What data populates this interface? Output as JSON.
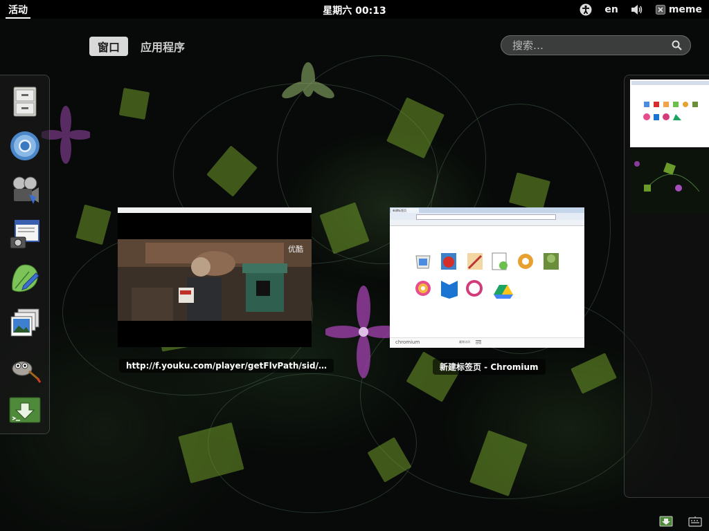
{
  "topbar": {
    "activities": "活动",
    "clock": "星期六 00:13",
    "keyboard_layout": "en",
    "user_name": "meme"
  },
  "overview": {
    "tab_windows": "窗口",
    "tab_applications": "应用程序",
    "search_placeholder": "搜索…"
  },
  "windows": [
    {
      "label": "http://f.youku.com/player/getFlvPath/sid/…",
      "watermark": "优酷"
    },
    {
      "label": "新建标签页 - Chromium",
      "tab_title": "新建标签页",
      "apps": [
        "Chrome Web Store",
        "Angry Birds",
        "Photo Compare",
        "Google Docs",
        "台球大师",
        "Plants vs Zombies",
        "Pixlr-o-matic",
        "Google Play Books",
        "Photo Speaker",
        "Google 云端硬盘"
      ],
      "footer_brand": "chromium",
      "footer_tabs": [
        "最常访问",
        "应用"
      ]
    }
  ],
  "dash": {
    "apps": [
      "file-cabinet",
      "chromium-browser",
      "media-player",
      "screenshot-tool",
      "text-editor",
      "image-viewer",
      "gimp",
      "terminal-install"
    ]
  }
}
